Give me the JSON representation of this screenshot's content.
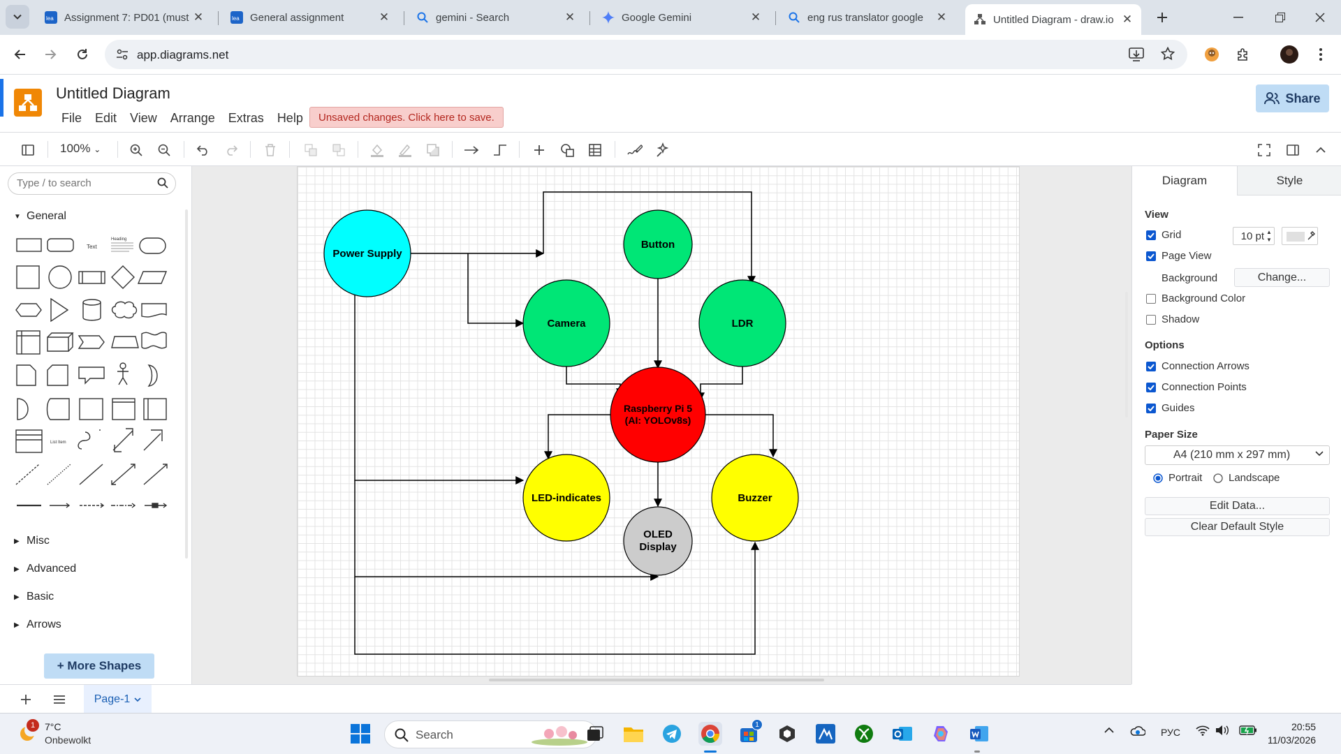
{
  "browser": {
    "tabs": [
      {
        "title": "Assignment 7: PD01 (must",
        "icon": "moodle-icon"
      },
      {
        "title": "General assignment",
        "icon": "moodle-icon"
      },
      {
        "title": "gemini - Search",
        "icon": "search-icon"
      },
      {
        "title": "Google Gemini",
        "icon": "gemini-icon"
      },
      {
        "title": "eng rus translator google",
        "icon": "search-icon"
      },
      {
        "title": "Untitled Diagram - draw.io",
        "icon": "drawio-icon",
        "active": true
      }
    ],
    "url": "app.diagrams.net"
  },
  "app": {
    "title": "Untitled Diagram",
    "menu": [
      "File",
      "Edit",
      "View",
      "Arrange",
      "Extras",
      "Help"
    ],
    "unsaved_notice": "Unsaved changes. Click here to save.",
    "share_label": "Share",
    "zoom": "100%"
  },
  "left_panel": {
    "search_placeholder": "Type / to search",
    "general_label": "General",
    "sections": [
      "Misc",
      "Advanced",
      "Basic",
      "Arrows"
    ],
    "more_shapes": "+ More Shapes",
    "shape_text_label": "Text",
    "shape_heading_label": "Heading",
    "shape_list_label": "List Item"
  },
  "diagram": {
    "nodes": [
      {
        "id": "power",
        "label": "Power Supply",
        "color": "#00ffff"
      },
      {
        "id": "button",
        "label": "Button",
        "color": "#00e676"
      },
      {
        "id": "camera",
        "label": "Camera",
        "color": "#00e676"
      },
      {
        "id": "ldr",
        "label": "LDR",
        "color": "#00e676"
      },
      {
        "id": "rpi",
        "label_line1": "Raspberry Pi 5",
        "label_line2": "(AI: YOLOv8s)",
        "color": "#ff0000"
      },
      {
        "id": "led",
        "label": "LED-indicates",
        "color": "#ffff00"
      },
      {
        "id": "oled",
        "label_line1": "OLED",
        "label_line2": "Display",
        "color": "#cccccc"
      },
      {
        "id": "buzzer",
        "label": "Buzzer",
        "color": "#ffff00"
      }
    ]
  },
  "right_panel": {
    "tabs": [
      "Diagram",
      "Style"
    ],
    "view_label": "View",
    "grid_label": "Grid",
    "grid_size": "10 pt",
    "page_view_label": "Page View",
    "background_label": "Background",
    "change_label": "Change...",
    "background_color_label": "Background Color",
    "shadow_label": "Shadow",
    "options_label": "Options",
    "connection_arrows_label": "Connection Arrows",
    "connection_points_label": "Connection Points",
    "guides_label": "Guides",
    "paper_size_label": "Paper Size",
    "paper_size_value": "A4 (210 mm x 297 mm)",
    "portrait_label": "Portrait",
    "landscape_label": "Landscape",
    "edit_data_label": "Edit Data...",
    "clear_style_label": "Clear Default Style"
  },
  "bottom": {
    "page_tab": "Page-1"
  },
  "taskbar": {
    "temp": "7°C",
    "weather": "Onbewolkt",
    "weather_badge": "1",
    "search_label": "Search",
    "store_badge": "1",
    "lang": "РУС",
    "time": "20:55",
    "date": "11/03/2026"
  }
}
